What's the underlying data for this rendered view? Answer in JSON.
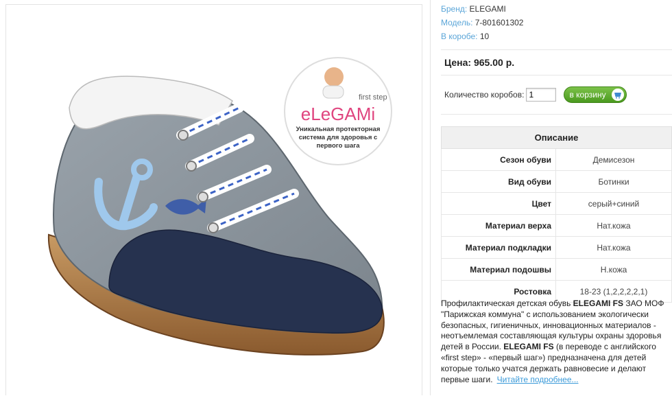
{
  "meta": {
    "brand_label": "Бренд:",
    "brand_value": "ELEGAMI",
    "model_label": "Модель:",
    "model_value": "7-801601302",
    "box_label": "В коробе:",
    "box_value": "10"
  },
  "price": {
    "label": "Цена: 965.00 р."
  },
  "order": {
    "qty_label": "Количество коробов:",
    "qty_value": "1",
    "cart_label": "в корзину"
  },
  "logo": {
    "first_step": "first step",
    "brand": "eLeGAMi",
    "tagline_1": "Уникальная протекторная",
    "tagline_2": "система для здоровья с",
    "tagline_3": "первого шага"
  },
  "spec": {
    "header": "Описание",
    "rows": [
      {
        "key": "Сезон обуви",
        "value": "Демисезон"
      },
      {
        "key": "Вид обуви",
        "value": "Ботинки"
      },
      {
        "key": "Цвет",
        "value": "серый+синий"
      },
      {
        "key": "Материал верха",
        "value": "Нат.кожа"
      },
      {
        "key": "Материал подкладки",
        "value": "Нат.кожа"
      },
      {
        "key": "Материал подошвы",
        "value": "Н.кожа"
      },
      {
        "key": "Ростовка",
        "value": "18-23 (1,2,2,2,2,1)"
      }
    ]
  },
  "description": {
    "p1": "Профилактическая детская обувь ",
    "b1": "ELEGAMI FS",
    "p2": " ЗАО МОФ \"Парижская коммуна\" с использованием экологически безопасных, гигиеничных, инновационных материалов - неотъемлемая составляющая культуры охраны здоровья детей в России. ",
    "b2": "ELEGAMI FS",
    "p3": " (в переводе с английского «first step» - «первый шаг») предназначена для детей которые только учатся держать равновесие и делают первые шаги.",
    "more": "Читайте подробнее..."
  },
  "colors": {
    "link": "#5aa5d8",
    "button": "#5aaa2a"
  }
}
